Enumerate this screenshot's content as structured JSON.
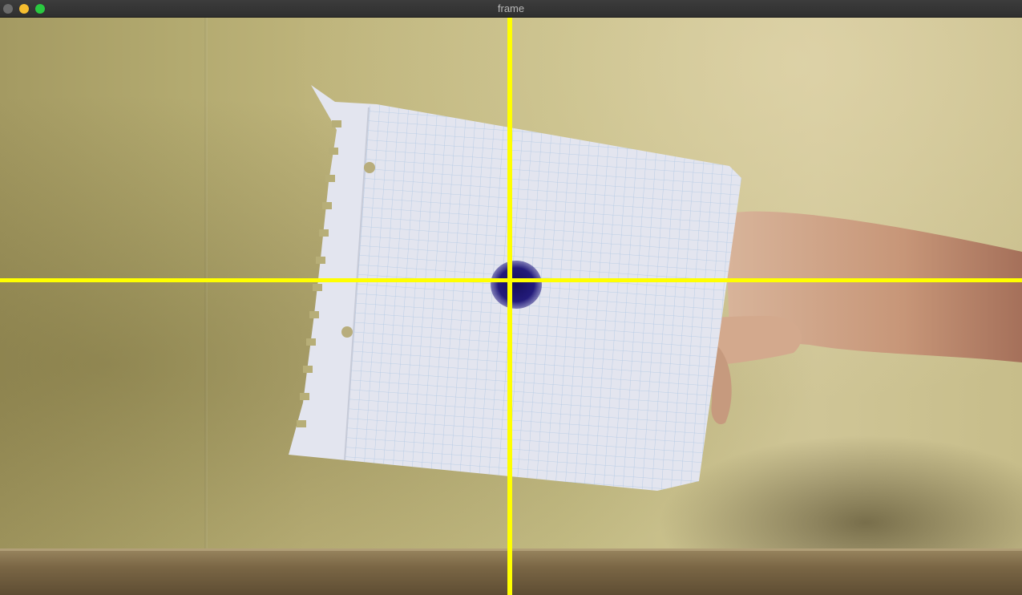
{
  "window": {
    "title": "frame",
    "buttons": [
      "close",
      "minimize",
      "zoom"
    ]
  },
  "camera_view": {
    "description_icon": "webcam-feed",
    "crosshair_color": "#ffff00",
    "marker_color": "#1d1870"
  }
}
